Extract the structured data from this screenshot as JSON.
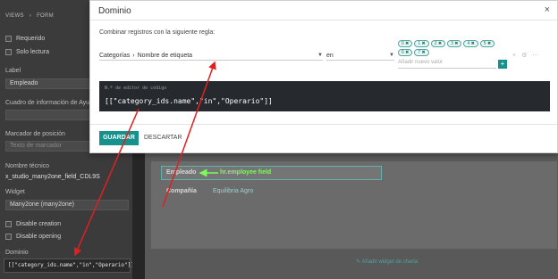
{
  "sidebar": {
    "breadcrumbs": [
      "VIEWS",
      "FORM"
    ],
    "checkboxes": [
      "Requerido",
      "Solo lectura"
    ],
    "label_title": "Label",
    "label_value": "Empleado",
    "help_title": "Cuadro de información de Ayuda",
    "placeholder_title": "Marcador de posición",
    "placeholder_input": "Texto de marcador",
    "technical_title": "Nombre técnico",
    "technical_value": "x_studio_many2one_field_CDL9S",
    "widget_title": "Widget",
    "widget_value": "Many2one (many2one)",
    "disable_creation": "Disable creation",
    "disable_opening": "Disable opening",
    "domain_title": "Dominio",
    "domain_value": "[[\"category_ids.name\",\"in\",\"Operario\"]]"
  },
  "form": {
    "field1_label": "Empleado",
    "field1_annotation": "hr.employee field",
    "field2_label": "Compañía",
    "field2_value": "Equilibria Agro",
    "add_chart_widget": "Añadir widget de charla"
  },
  "modal": {
    "title": "Dominio",
    "close": "×",
    "rule_text": "Combinar registros con la siguiente regla:",
    "field_path_1": "Categorías",
    "field_path_2": "Nombre de etiqueta",
    "operator": "en",
    "tags": [
      "0 ✖",
      "1 ✖",
      "2 ✖",
      "3 ✖",
      "4 ✖",
      "5 ✖",
      "6 ✖",
      "7 ✖"
    ],
    "add_value_placeholder": "Añadir nuevo valor",
    "plus": "+",
    "code_label": "N.º de editor de código",
    "code_value": "[[\"category_ids.name\",\"in\",\"Operario\"]]",
    "save_label": "GUARDAR",
    "discard_label": "DESCARTAR"
  },
  "colors": {
    "accent": "#16918b",
    "annotation_green": "#7cfc5a",
    "arrow_red": "#e02020"
  }
}
